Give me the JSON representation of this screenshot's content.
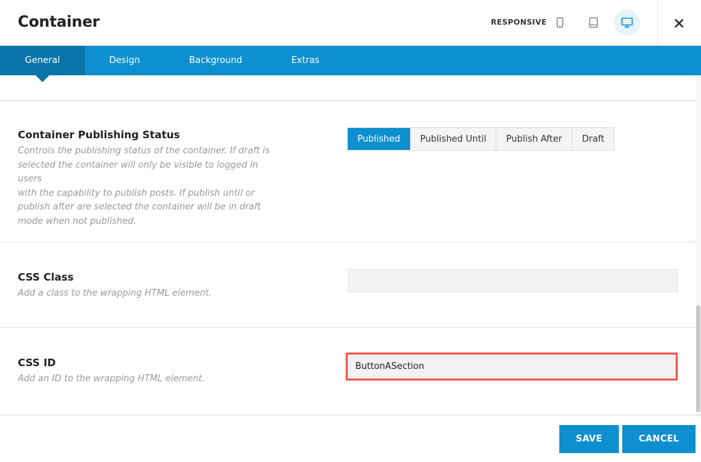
{
  "header": {
    "title": "Container",
    "responsive_label": "RESPONSIVE",
    "devices": [
      {
        "icon": "mobile-icon",
        "active": false
      },
      {
        "icon": "tablet-icon",
        "active": false
      },
      {
        "icon": "desktop-icon",
        "active": true
      }
    ],
    "close_icon": "close-icon"
  },
  "tabs": [
    {
      "label": "General",
      "active": true
    },
    {
      "label": "Design",
      "active": false
    },
    {
      "label": "Background",
      "active": false
    },
    {
      "label": "Extras",
      "active": false
    }
  ],
  "fields": {
    "publishing": {
      "title": "Container Publishing Status",
      "description_lines": [
        "Controls the publishing status of the container. If draft is",
        "selected the container will only be visible to logged in users",
        "with the capability to publish posts. If publish until or",
        "publish after are selected the container will be in draft",
        "mode when not published."
      ],
      "options": [
        "Published",
        "Published Until",
        "Publish After",
        "Draft"
      ],
      "selected": "Published"
    },
    "css_class": {
      "title": "CSS Class",
      "description": "Add a class to the wrapping HTML element.",
      "value": ""
    },
    "css_id": {
      "title": "CSS ID",
      "description": "Add an ID to the wrapping HTML element.",
      "value": "ButtonASection"
    }
  },
  "footer": {
    "save_label": "SAVE",
    "cancel_label": "CANCEL"
  },
  "colors": {
    "accent": "#0e8fcf",
    "accent_dark": "#0a73a8",
    "highlight": "#ed5a4f"
  }
}
